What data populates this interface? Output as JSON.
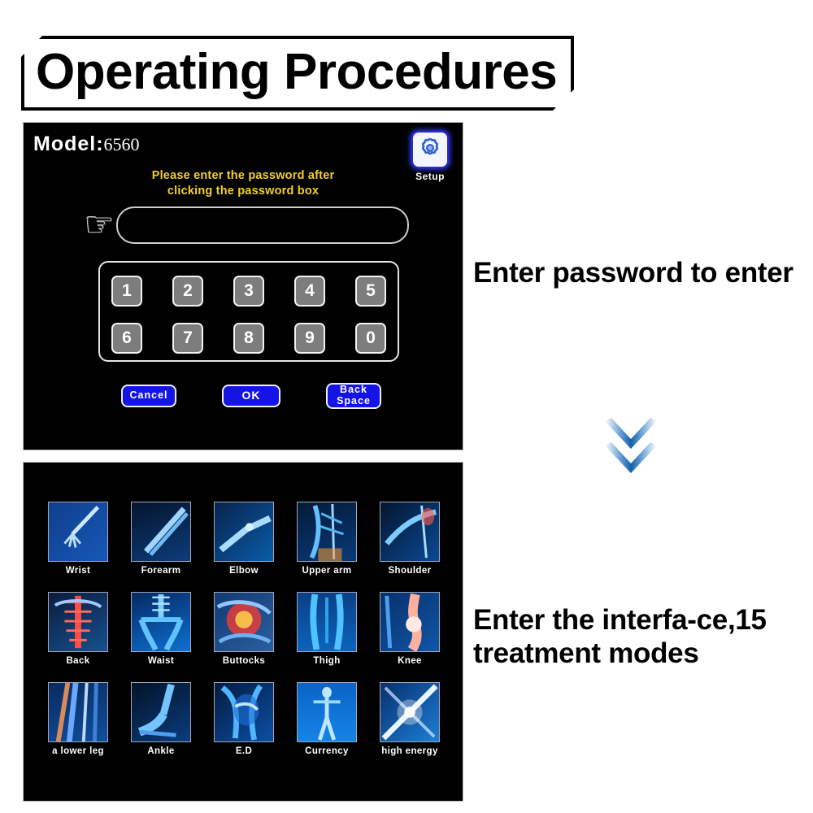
{
  "title": "Operating Procedures",
  "password_screen": {
    "model_label": "Model:",
    "model_value": "6560",
    "setup_label": "Setup",
    "setup_icon": "gear-icon",
    "hint_line1": "Please enter the password after",
    "hint_line2": "clicking the password box",
    "hand_icon": "pointing-hand-icon",
    "password_value": "",
    "password_placeholder": "",
    "keys_row1": [
      "1",
      "2",
      "3",
      "4",
      "5"
    ],
    "keys_row2": [
      "6",
      "7",
      "8",
      "9",
      "0"
    ],
    "cancel_label": "Cancel",
    "ok_label": "OK",
    "backspace_line1": "Back",
    "backspace_line2": "Space"
  },
  "modes_screen": {
    "modes": [
      {
        "label": "Wrist"
      },
      {
        "label": "Forearm"
      },
      {
        "label": "Elbow"
      },
      {
        "label": "Upper arm"
      },
      {
        "label": "Shoulder"
      },
      {
        "label": "Back"
      },
      {
        "label": "Waist"
      },
      {
        "label": "Buttocks"
      },
      {
        "label": "Thigh"
      },
      {
        "label": "Knee"
      },
      {
        "label": "a lower leg"
      },
      {
        "label": "Ankle"
      },
      {
        "label": "E.D"
      },
      {
        "label": "Currency"
      },
      {
        "label": "high energy"
      }
    ]
  },
  "captions": {
    "password": "Enter password to enter",
    "modes": "Enter the interfa-ce,15 treatment modes"
  },
  "arrow_icon": "double-chevron-down-icon",
  "colors": {
    "hint_yellow": "#f2d024",
    "button_blue": "#1414e6",
    "accent_blue": "#1f6fc4",
    "panel_black": "#000000",
    "key_gray": "#7d7d7d"
  }
}
